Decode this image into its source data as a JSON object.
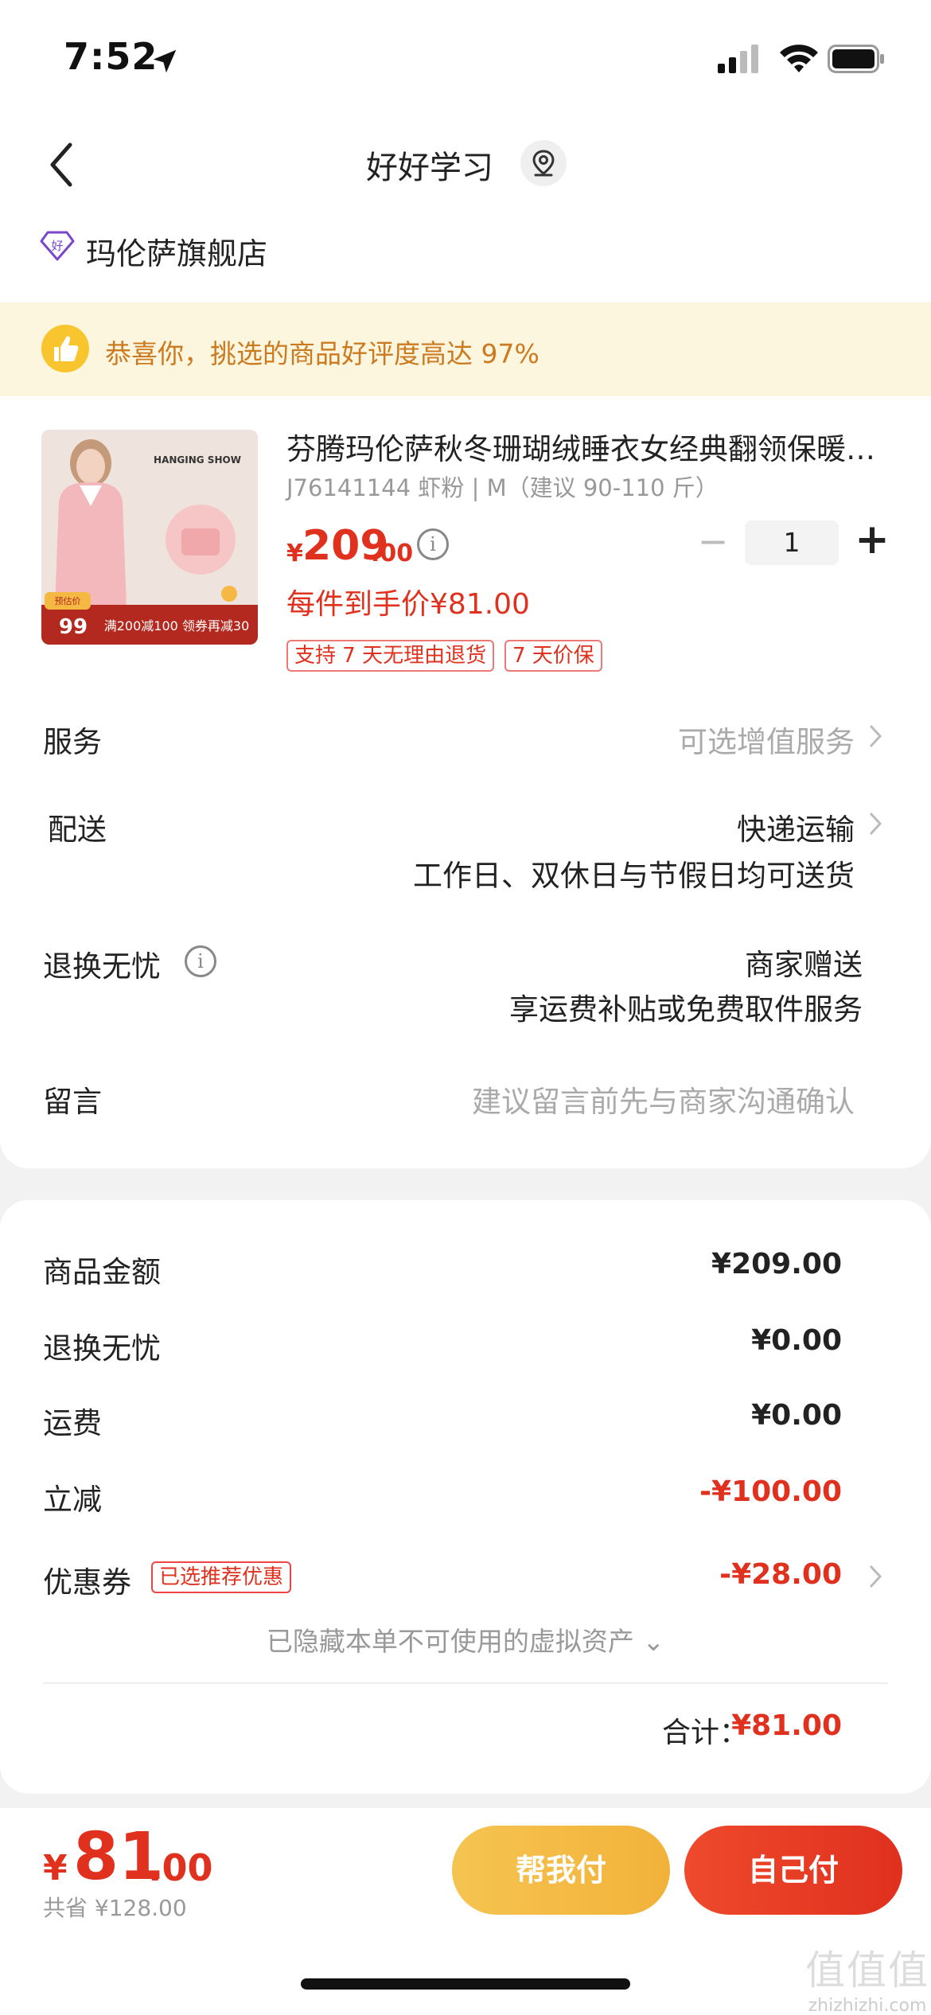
{
  "status_bar": {
    "time": "7:52"
  },
  "header": {
    "title": "好好学习"
  },
  "shop": {
    "name": "玛伦萨旗舰店",
    "icon": "shop-badge-icon"
  },
  "banner": {
    "text": "恭喜你，挑选的商品好评度高达 97%"
  },
  "product": {
    "title": "芬腾玛伦萨秋冬珊瑚绒睡衣女经典翻领保暖家居服",
    "sku": "J76141144 虾粉 | M（建议 90-110 斤）",
    "currency": "¥",
    "price_int": "209",
    "price_dec": ".00",
    "quantity": "1",
    "minus_label": "−",
    "plus_label": "+",
    "per_item_price": "每件到手价¥81.00",
    "tags": [
      "支持 7 天无理由退货",
      "7 天价保"
    ],
    "image": {
      "brand_text": "HANGING SHOW",
      "price_badge_label": "预估价",
      "price_badge_value": "99",
      "promo": "满200减100 领券再减30"
    }
  },
  "rows": {
    "service": {
      "label": "服务",
      "value": "可选增值服务"
    },
    "delivery": {
      "label": "配送",
      "value": "快递运输",
      "sub": "工作日、双休日与节假日均可送货"
    },
    "worry_free": {
      "label": "退换无忧",
      "value": "商家赠送",
      "sub": "享运费补贴或免费取件服务"
    },
    "message": {
      "label": "留言",
      "placeholder": "建议留言前先与商家沟通确认"
    }
  },
  "summary": {
    "goods": {
      "label": "商品金额",
      "value": "¥209.00"
    },
    "worry_free": {
      "label": "退换无忧",
      "value": "¥0.00"
    },
    "shipping": {
      "label": "运费",
      "value": "¥0.00"
    },
    "discount": {
      "label": "立减",
      "value": "-¥100.00"
    },
    "coupon": {
      "label": "优惠券",
      "badge": "已选推荐优惠",
      "value": "-¥28.00"
    },
    "hidden_assets": "已隐藏本单不可使用的虚拟资产 ⌄",
    "total_label": "合计：",
    "total_value": "¥81.00"
  },
  "bottom": {
    "currency": "¥",
    "amount_int": "81",
    "amount_dec": ".00",
    "saved": "共省 ¥128.00",
    "help_pay": "帮我付",
    "self_pay": "自己付"
  },
  "watermark": {
    "big": "值值值",
    "small": "zhizhizhi.com"
  },
  "colors": {
    "accent": "#e0301e",
    "help_button": "#f2b23a",
    "banner_bg": "#fdf6df",
    "banner_text": "#cc7a1f"
  }
}
